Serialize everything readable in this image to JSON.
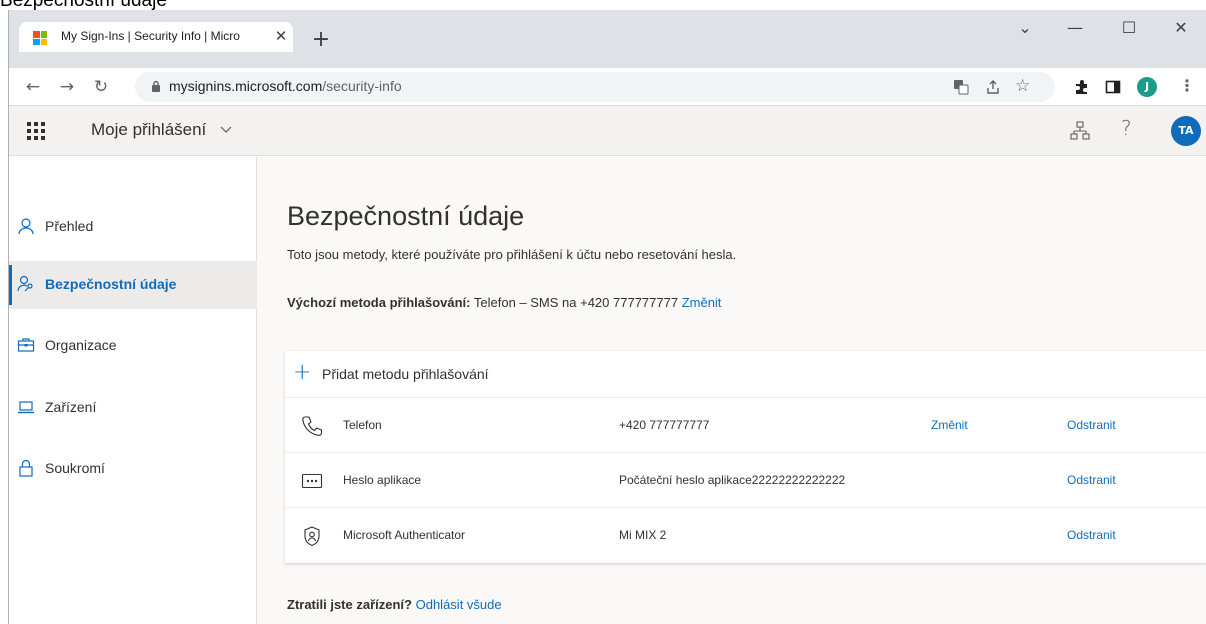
{
  "caption": "Bezpečnostní údaje",
  "browser": {
    "tab_title": "My Sign-Ins | Security Info | Micro",
    "tab_close": "✕",
    "new_tab": "+",
    "url_host": "mysignins.microsoft.com",
    "url_path": "/security-info",
    "profile_initial": "J",
    "window": {
      "dropdown": "⌄",
      "minimize": "—",
      "maximize": "☐",
      "close": "✕"
    },
    "colors": {
      "ms_red": "#f25022",
      "ms_green": "#7fba00",
      "ms_blue": "#00a4ef",
      "ms_yellow": "#ffb900"
    }
  },
  "app": {
    "title": "Moje přihlášení",
    "help": "?",
    "avatar_initials": "TA",
    "accent": "#0f6cbd"
  },
  "sidebar": {
    "items": [
      {
        "label": "Přehled",
        "icon": "person-icon",
        "active": false
      },
      {
        "label": "Bezpečnostní údaje",
        "icon": "person-key-icon",
        "active": true
      },
      {
        "label": "Organizace",
        "icon": "briefcase-icon",
        "active": false
      },
      {
        "label": "Zařízení",
        "icon": "laptop-icon",
        "active": false
      },
      {
        "label": "Soukromí",
        "icon": "lock-icon",
        "active": false
      }
    ]
  },
  "main": {
    "title": "Bezpečnostní údaje",
    "description": "Toto jsou metody, které používáte pro přihlášení k účtu nebo resetování hesla.",
    "default_label": "Výchozí metoda přihlašování:",
    "default_value": " Telefon – SMS na +420 777777777 ",
    "default_change": "Změnit",
    "add_method": "Přidat metodu přihlašování",
    "methods": [
      {
        "name": "Telefon",
        "value": "+420 777777777",
        "change": "Změnit",
        "remove": "Odstranit",
        "icon": "phone-icon"
      },
      {
        "name": "Heslo aplikace",
        "value": "Počáteční heslo aplikace22222222222222",
        "change": "",
        "remove": "Odstranit",
        "icon": "password-icon"
      },
      {
        "name": "Microsoft Authenticator",
        "value": "Mi MIX 2",
        "change": "",
        "remove": "Odstranit",
        "icon": "authenticator-icon"
      }
    ],
    "lost_label": "Ztratili jste zařízení?",
    "lost_link": "Odhlásit všude"
  }
}
